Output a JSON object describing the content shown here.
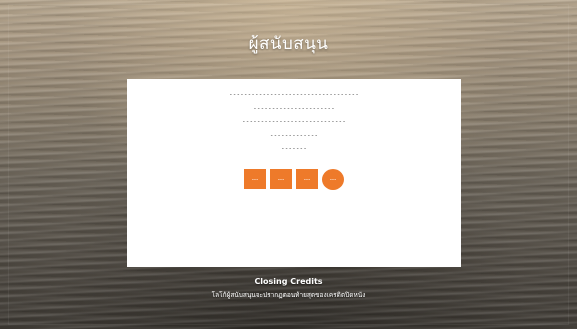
{
  "header": {
    "title": "ผู้สนับสนุน"
  },
  "credits": {
    "lines": [
      "-----------------------------------",
      "----------------------",
      "----------------------------",
      "-------------",
      "-------"
    ]
  },
  "social": [
    {
      "icon": "square-link-icon",
      "label": "---"
    },
    {
      "icon": "square-link-icon",
      "label": "---"
    },
    {
      "icon": "square-link-icon",
      "label": "---"
    },
    {
      "icon": "circle-link-icon",
      "label": "---"
    }
  ],
  "footer": {
    "title": "Closing Credits",
    "subtitle": "โลโก้ผู้สนับสนุนจะปรากฏตอนท้ายสุดของเครดิตปิดหนัง"
  },
  "colors": {
    "accent": "#ee7a2a",
    "panel": "#ffffff",
    "text": "#ffffff"
  }
}
